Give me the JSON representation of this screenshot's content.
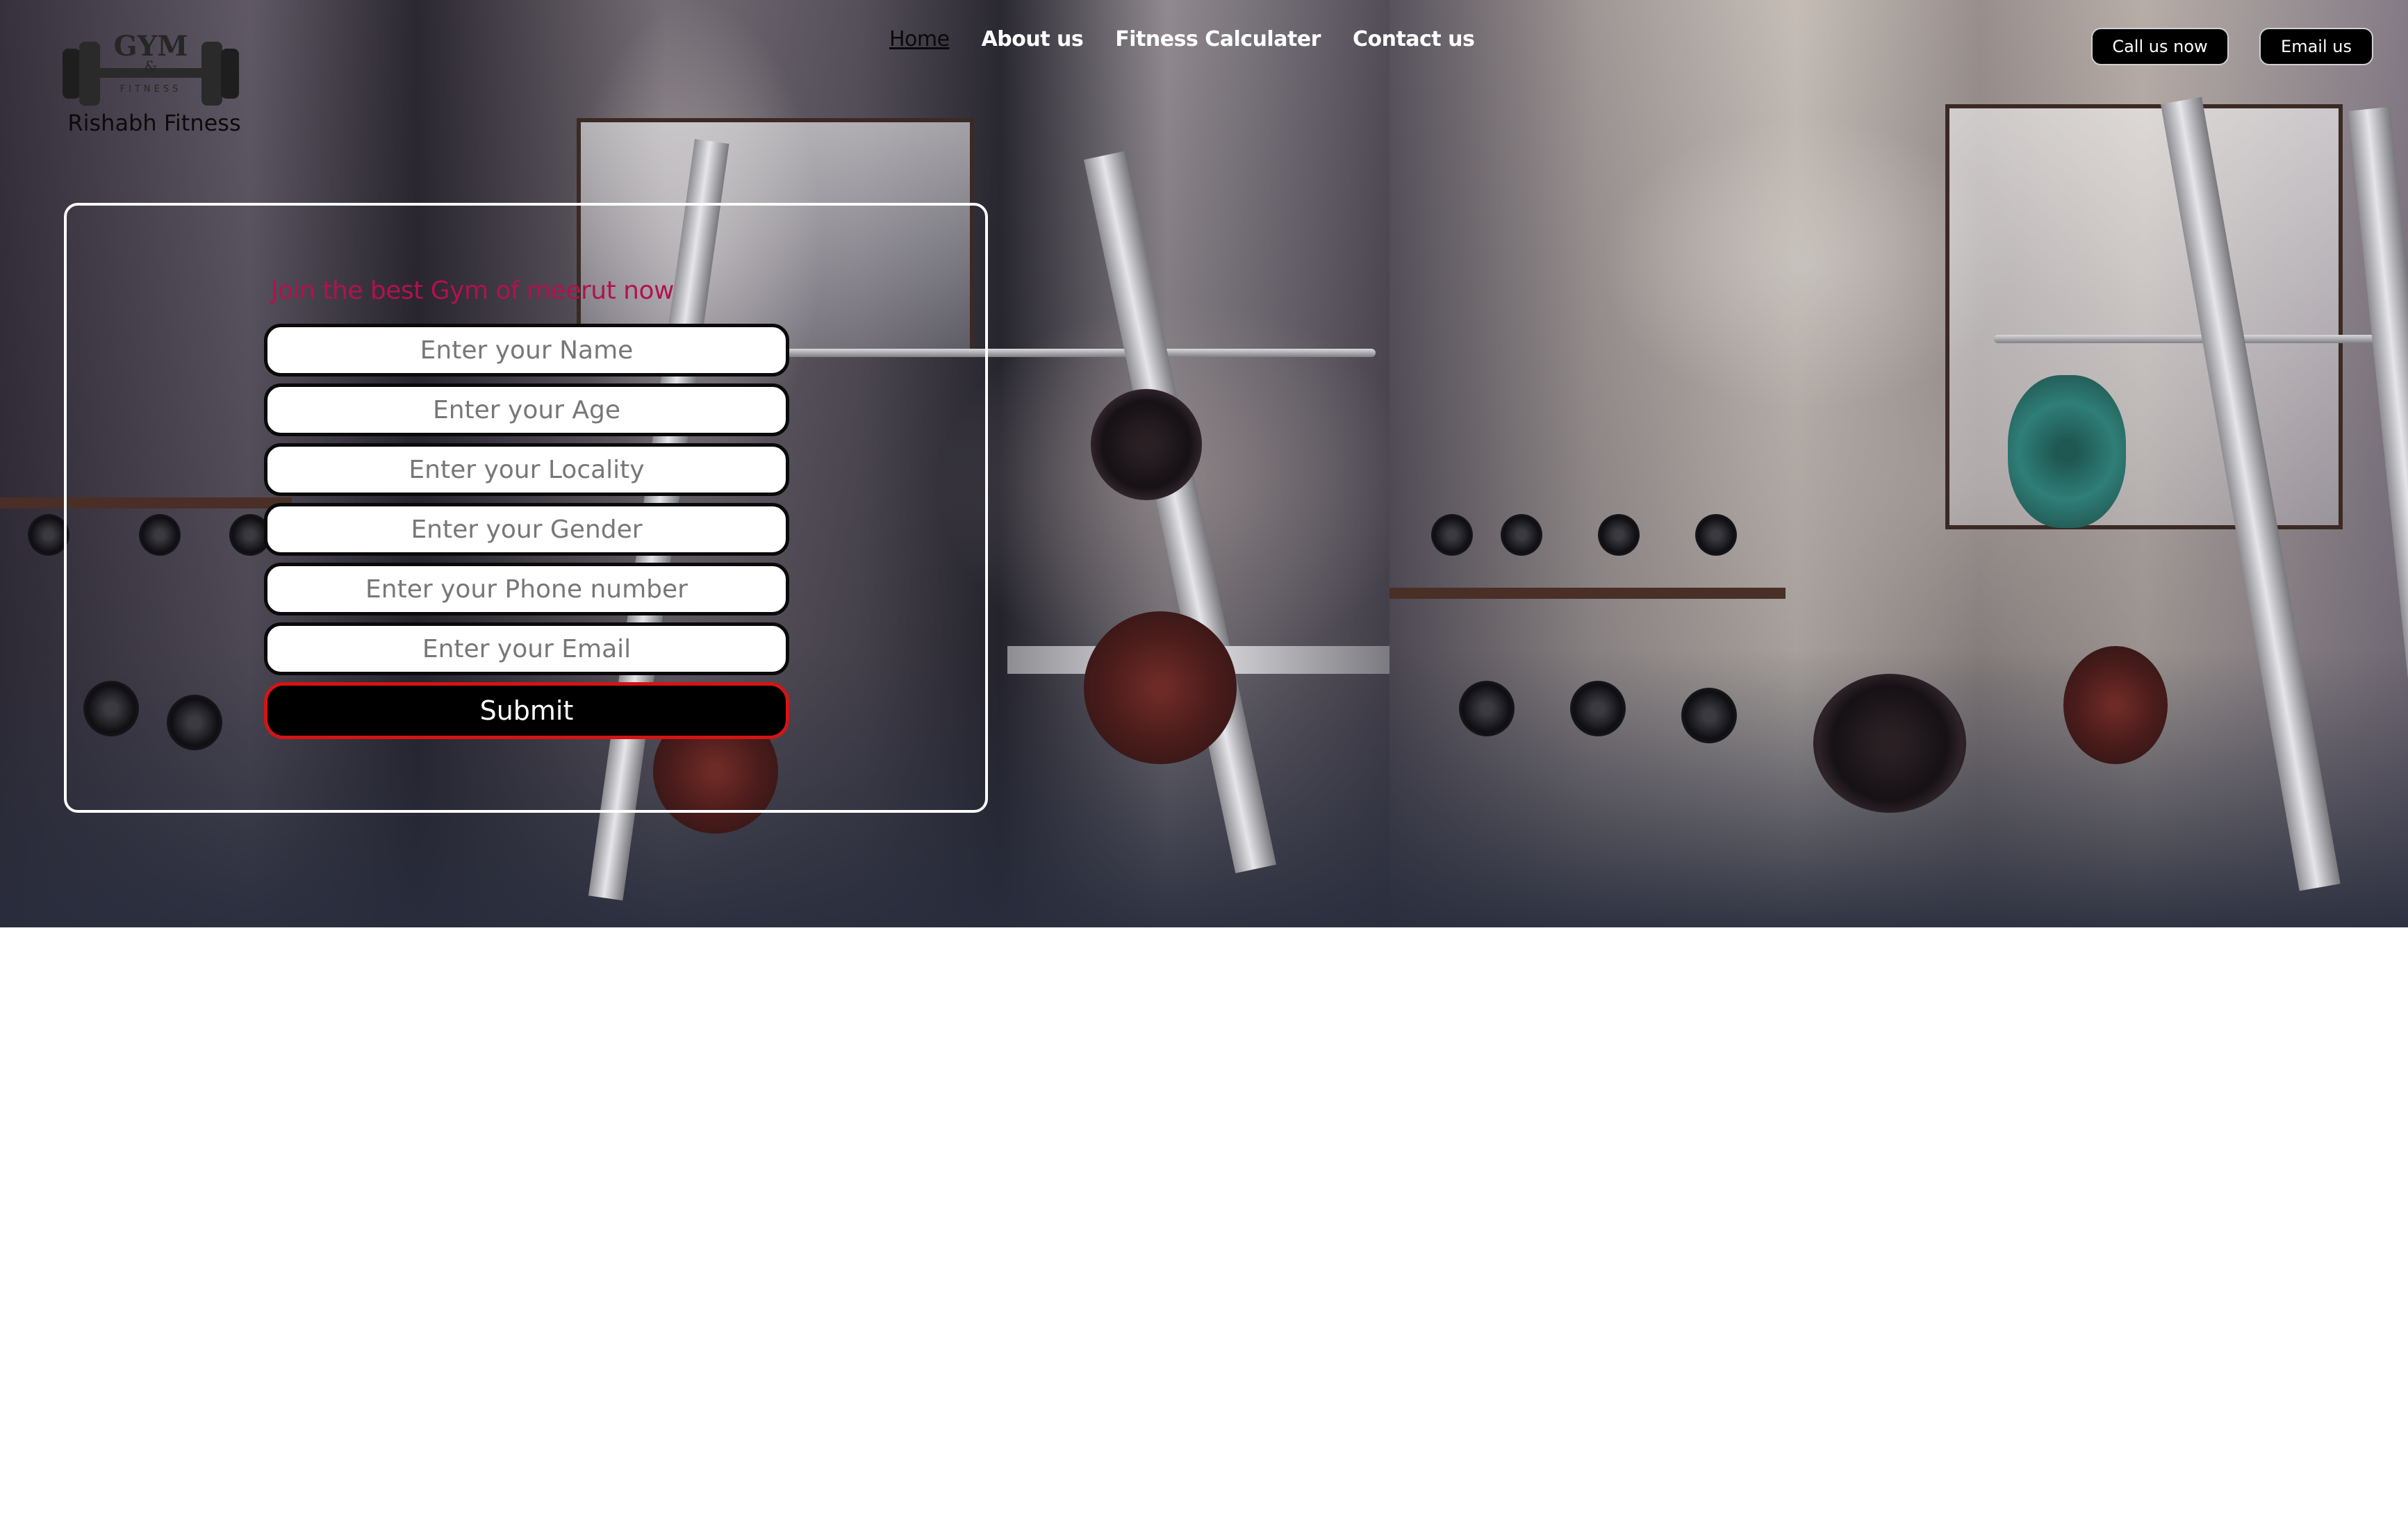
{
  "brand": {
    "logo_icon": "dumbbell-icon",
    "logo_text_top": "GYM",
    "logo_text_mid": "&",
    "logo_text_bottom": "FITNESS",
    "caption": "Rishabh Fitness"
  },
  "nav": {
    "items": [
      {
        "label": "Home",
        "active": true
      },
      {
        "label": "About us",
        "active": false
      },
      {
        "label": "Fitness Calculater",
        "active": false
      },
      {
        "label": "Contact us",
        "active": false
      }
    ]
  },
  "actions": {
    "call_label": "Call us now",
    "email_label": "Email us"
  },
  "form": {
    "title": "Join the best Gym of meerut now",
    "fields": [
      {
        "placeholder": "Enter your Name",
        "value": ""
      },
      {
        "placeholder": "Enter your Age",
        "value": ""
      },
      {
        "placeholder": "Enter your Locality",
        "value": ""
      },
      {
        "placeholder": "Enter your Gender",
        "value": ""
      },
      {
        "placeholder": "Enter your Phone number",
        "value": ""
      },
      {
        "placeholder": "Enter your Email",
        "value": ""
      }
    ],
    "submit_label": "Submit"
  },
  "colors": {
    "form_title": "#b1124e",
    "submit_border": "#d51414",
    "button_bg": "#000000",
    "nav_text": "#ffffff"
  }
}
